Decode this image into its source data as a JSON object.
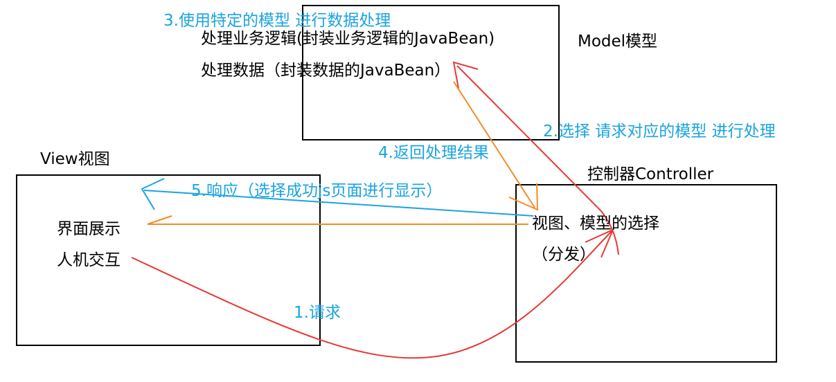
{
  "colors": {
    "text": "#000000",
    "label_blue": "#1aa3e0",
    "arrow_red": "#e53935",
    "arrow_orange": "#f28c28",
    "arrow_blue": "#1aa3e0",
    "box_border": "#000000"
  },
  "model": {
    "title": "Model模型",
    "line1": "处理业务逻辑(封装业务逻辑的JavaBean)",
    "line2": "处理数据（封装数据的JavaBean）"
  },
  "view": {
    "title": "View视图",
    "line1": "界面展示",
    "line2": "人机交互"
  },
  "controller": {
    "title": "控制器Controller",
    "line1": "视图、模型的选择",
    "line2": "（分发）"
  },
  "steps": {
    "step1": "1.请求",
    "step2": "2.选择 请求对应的模型 进行处理",
    "step3": "3.使用特定的模型 进行数据处理",
    "step4": "4.返回处理结果",
    "step5": "5.响应（选择成功js页面进行显示）"
  }
}
